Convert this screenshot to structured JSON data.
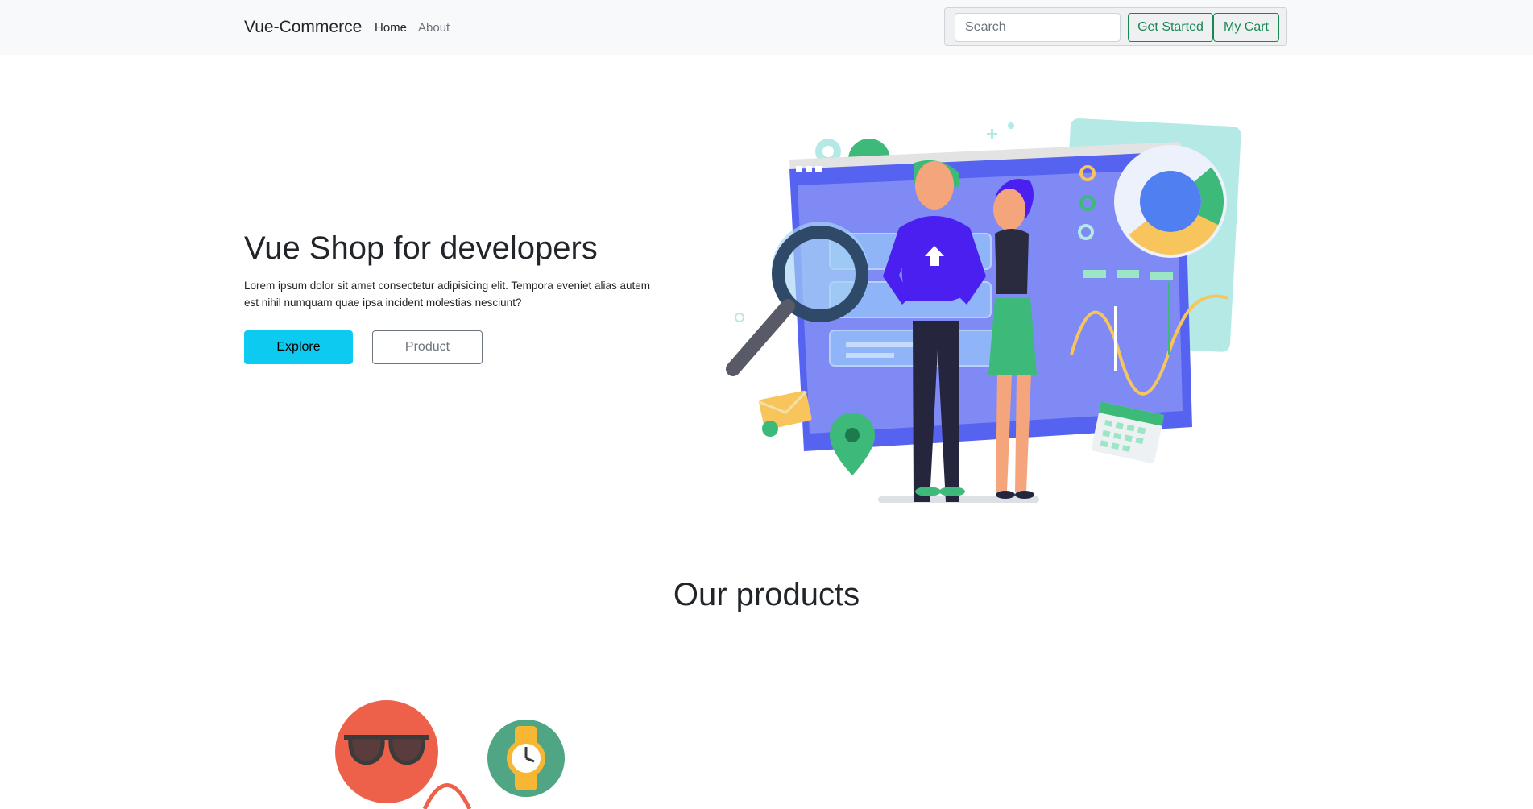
{
  "navbar": {
    "brand": "Vue-Commerce",
    "links": [
      {
        "label": "Home",
        "active": true
      },
      {
        "label": "About",
        "active": false
      }
    ],
    "search": {
      "placeholder": "Search",
      "value": ""
    },
    "buttons": {
      "get_started": "Get Started",
      "my_cart": "My Cart"
    }
  },
  "hero": {
    "title": "Vue Shop for developers",
    "text": "Lorem ipsum dolor sit amet consectetur adipisicing elit. Tempora eveniet alias autem est nihil numquam quae ipsa incident molestias nesciunt?",
    "buttons": {
      "explore": "Explore",
      "product": "Product"
    },
    "illustration": "developers-dashboard-illustration"
  },
  "products": {
    "title": "Our products",
    "icons": [
      "sunglasses-icon",
      "watch-icon"
    ]
  },
  "colors": {
    "navbar_bg": "#f8f9fa",
    "success": "#198754",
    "info": "#0dcaf0",
    "secondary": "#6c757d"
  }
}
